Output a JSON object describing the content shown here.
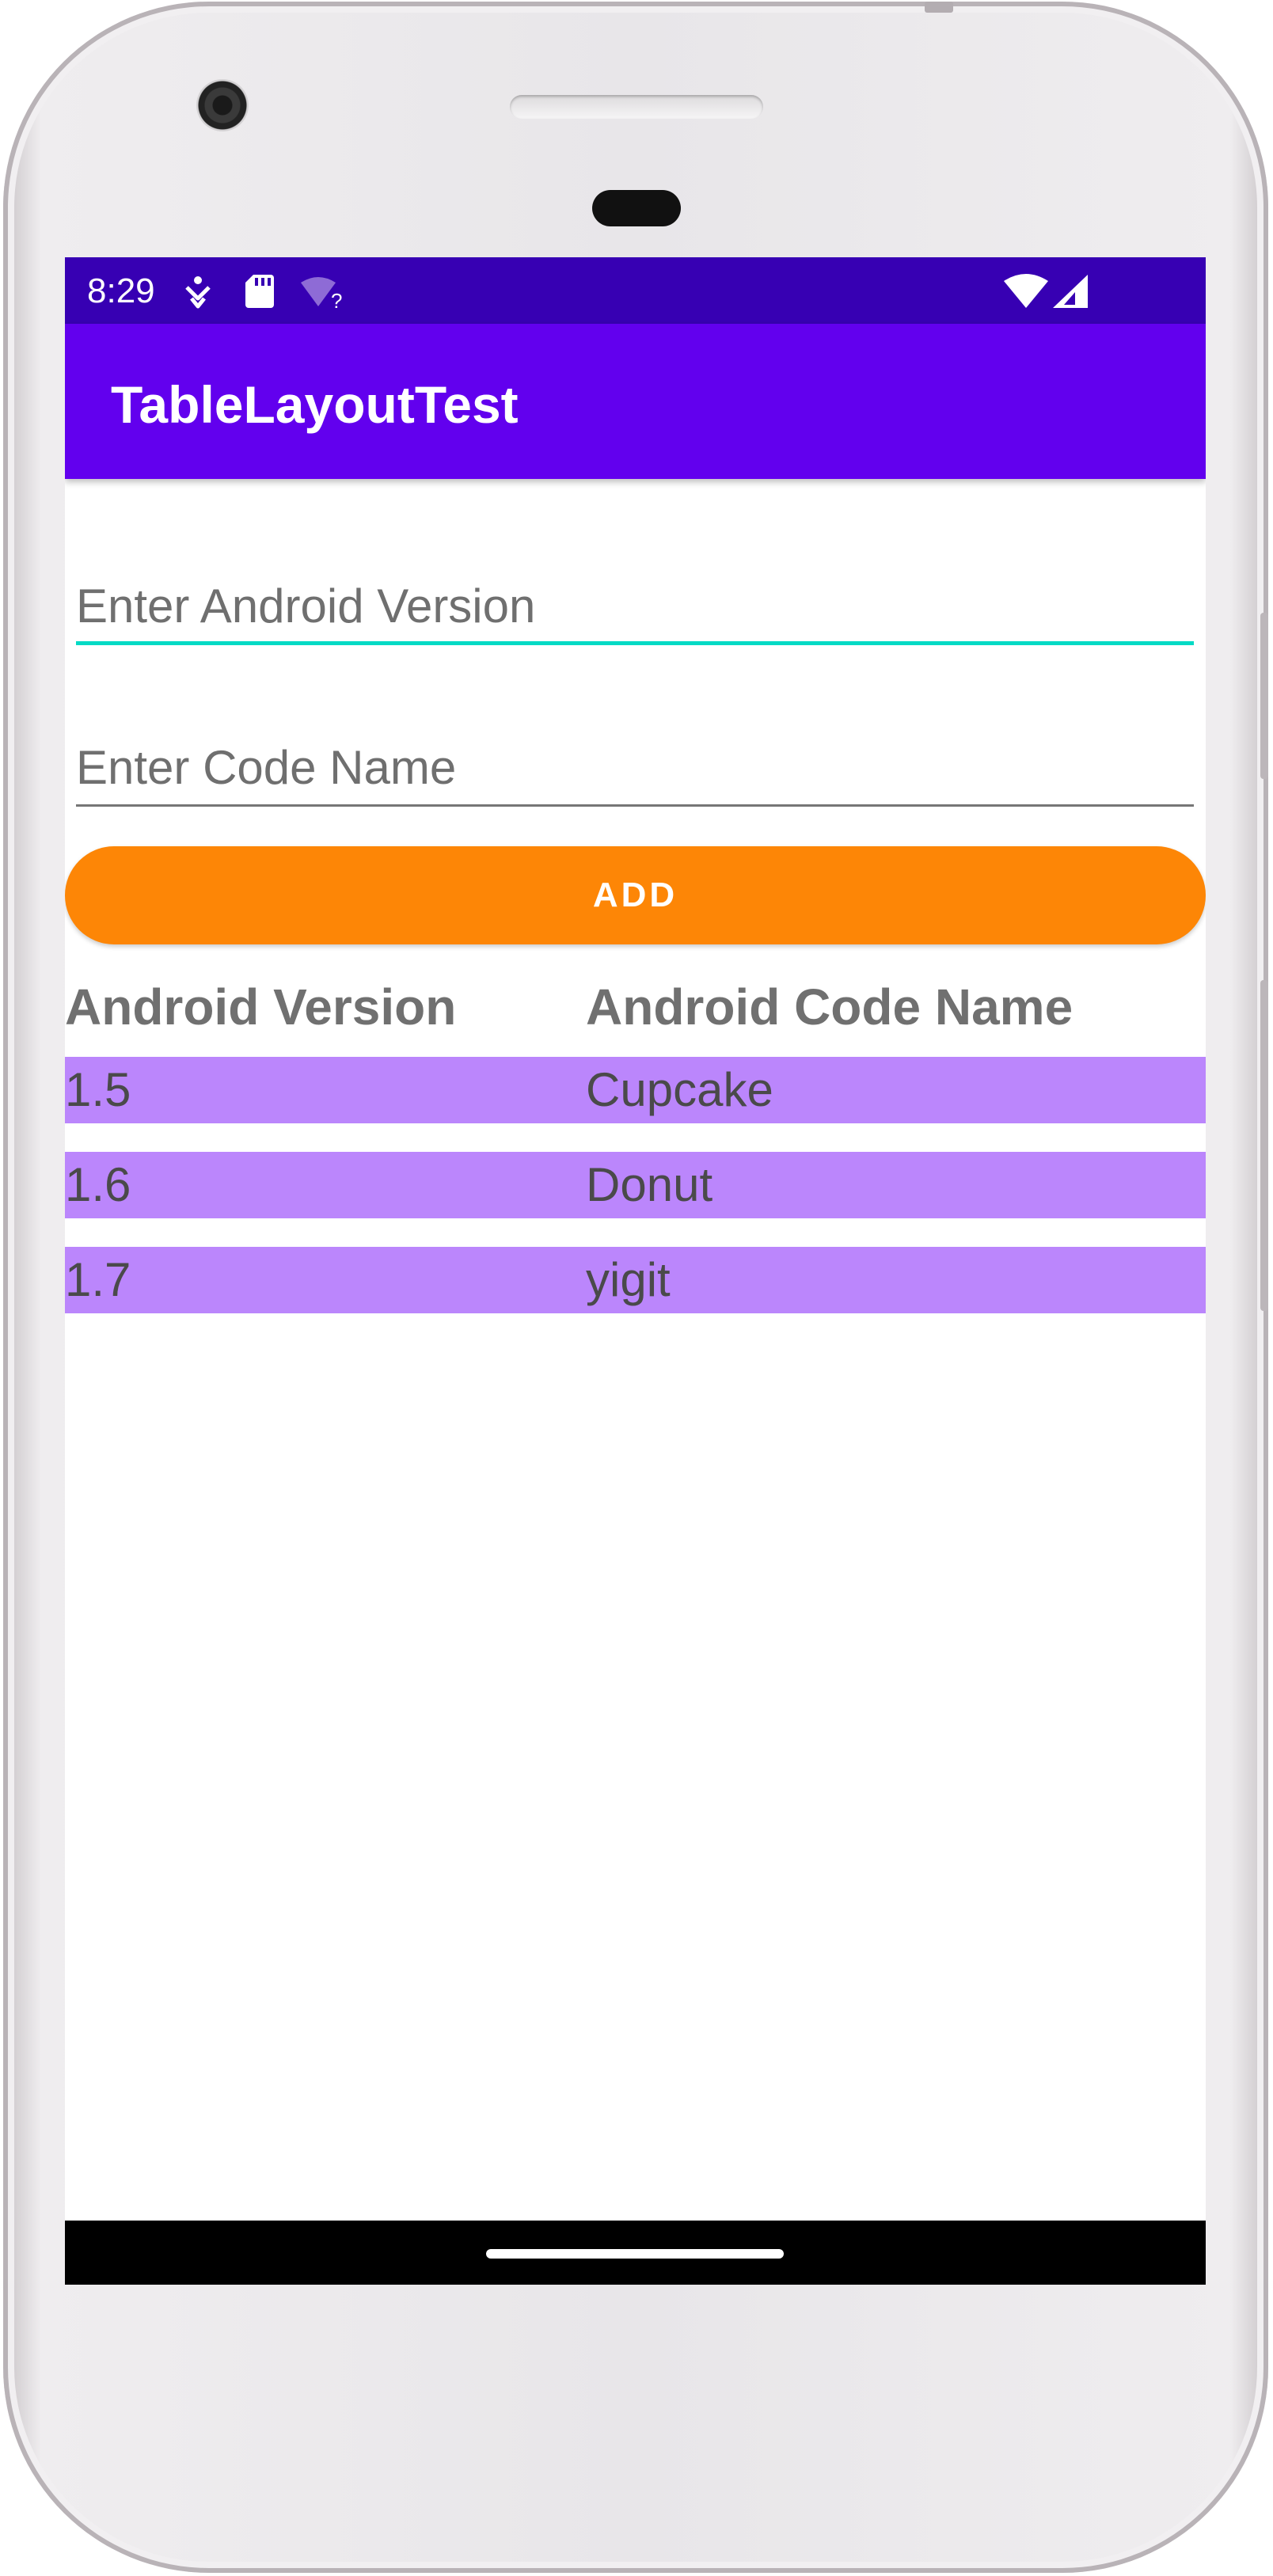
{
  "status_bar": {
    "time": "8:29",
    "icons_left": [
      "accessibility-icon",
      "sd-card-icon",
      "wifi-unknown-icon"
    ],
    "icons_right": [
      "wifi-icon",
      "cell-signal-icon"
    ]
  },
  "app_bar": {
    "title": "TableLayoutTest"
  },
  "form": {
    "version_placeholder": "Enter Android Version",
    "version_value": "",
    "codename_placeholder": "Enter Code Name",
    "codename_value": "",
    "add_label": "ADD"
  },
  "table": {
    "headers": [
      "Android Version",
      "Android Code Name"
    ],
    "rows": [
      {
        "version": "1.5",
        "codename": "Cupcake"
      },
      {
        "version": "1.6",
        "codename": "Donut"
      },
      {
        "version": "1.7",
        "codename": "yigit"
      }
    ]
  },
  "colors": {
    "status_bar": "#3700b3",
    "app_bar": "#6200ee",
    "accent_underline": "#03dac5",
    "button": "#fd8606",
    "row_background": "#bb86fc"
  }
}
